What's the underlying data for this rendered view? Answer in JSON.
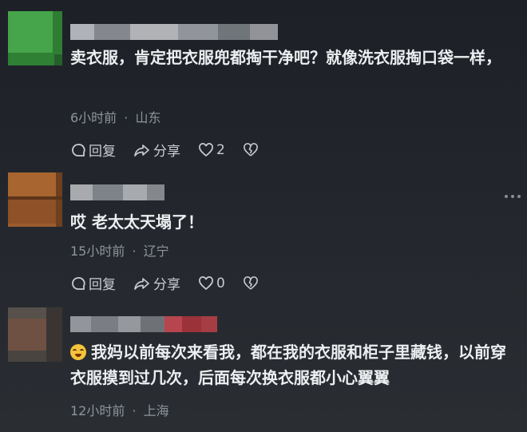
{
  "comments": [
    {
      "text": "卖衣服，肯定把衣服兜都掏干净吧？就像洗衣服掏口袋一样，",
      "time": "6小时前",
      "location": "山东",
      "reply_label": "回复",
      "share_label": "分享",
      "like_count": "2",
      "avatar_color": "#3a9a3f"
    },
    {
      "text": "哎 老太太天塌了！",
      "time": "15小时前",
      "location": "辽宁",
      "reply_label": "回复",
      "share_label": "分享",
      "like_count": "0",
      "avatar_color": "#9b5a2c"
    },
    {
      "text": "我妈以前每次来看我，都在我的衣服和柜子里藏钱，以前穿衣服摸到过几次，后面每次换衣服都小心翼翼",
      "time": "12小时前",
      "location": "上海",
      "avatar_color": "#6b5042"
    }
  ],
  "separator": "·"
}
